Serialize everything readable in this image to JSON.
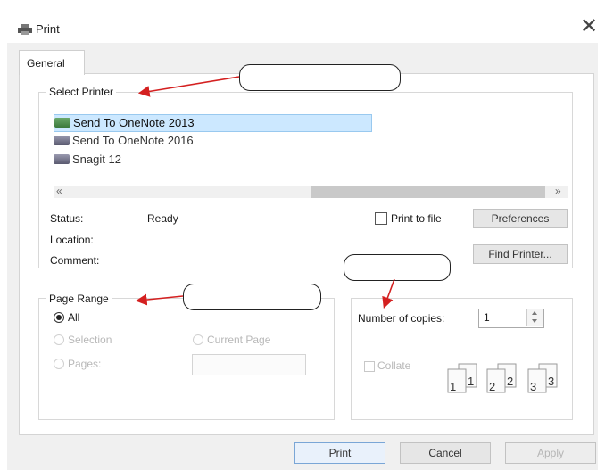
{
  "window": {
    "title": "Print",
    "close_glyph": "✕"
  },
  "tabs": [
    {
      "label": "General"
    }
  ],
  "select_printer": {
    "label": "Select Printer",
    "printers": [
      {
        "name": "Send To OneNote 2013",
        "selected": true
      },
      {
        "name": "Send To OneNote 2016",
        "selected": false
      },
      {
        "name": "Snagit 12",
        "selected": false
      }
    ],
    "scroll_left": "«",
    "scroll_right": "»"
  },
  "status": {
    "status_label": "Status:",
    "status_value": "Ready",
    "location_label": "Location:",
    "comment_label": "Comment:"
  },
  "print_to_file": {
    "label": "Print to file",
    "checked": false
  },
  "buttons": {
    "preferences": "Preferences",
    "find_printer": "Find Printer...",
    "print": "Print",
    "cancel": "Cancel",
    "apply": "Apply"
  },
  "page_range": {
    "label": "Page Range",
    "all": "All",
    "selection": "Selection",
    "current_page": "Current Page",
    "pages": "Pages:",
    "selected": "all"
  },
  "copies": {
    "label": "Number of copies:",
    "value": "1",
    "collate_label": "Collate",
    "collate_checked": false,
    "collate_numbers": [
      "1",
      "1",
      "2",
      "2",
      "3",
      "3"
    ]
  },
  "colors": {
    "arrow": "#d42020",
    "selection_bg": "#cce8ff",
    "default_button_border": "#7aa6d6"
  }
}
